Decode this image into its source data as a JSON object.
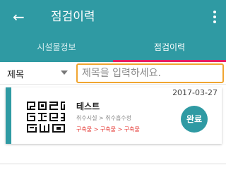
{
  "appbar": {
    "title": "점검이력",
    "back_icon": "arrow-left-icon",
    "more_icon": "more-vert-icon",
    "color": "#2f9aa3"
  },
  "tabs": [
    {
      "label": "시설물정보",
      "active": false
    },
    {
      "label": "점검이력",
      "active": true
    }
  ],
  "tab_indicator_color": "#e51e63",
  "search": {
    "field_selected": "제목",
    "placeholder": "제목을 입력하세요.",
    "value": "",
    "border_color": "#f0a530"
  },
  "list": {
    "items": [
      {
        "date": "2017-03-27",
        "title": "테스트",
        "subtitle": "취수시설 > 취수흡수정",
        "path": "구축물 > 구축물 > 구축물",
        "status": "완료",
        "thumbnail_icon": "qr-code-icon"
      }
    ]
  }
}
